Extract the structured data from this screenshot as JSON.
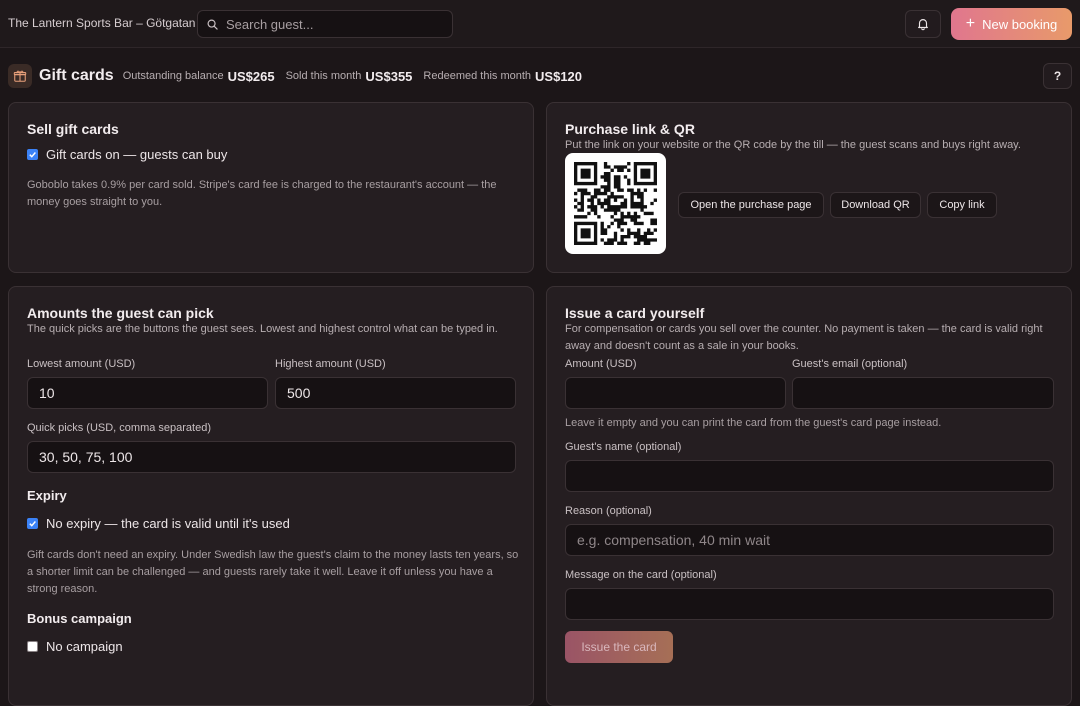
{
  "app": {
    "venue": "The Lantern Sports Bar – Götgatan",
    "search_placeholder": "Search guest...",
    "new_booking": "New booking"
  },
  "page": {
    "title": "Gift cards",
    "stats": [
      {
        "label": "Outstanding balance",
        "value": "US$265"
      },
      {
        "label": "Sold this month",
        "value": "US$355"
      },
      {
        "label": "Redeemed this month",
        "value": "US$120"
      }
    ],
    "help": "?"
  },
  "sell": {
    "title": "Sell gift cards",
    "toggle_label": "Gift cards on — guests can buy",
    "toggle_checked": true,
    "note": "Goboblo takes 0.9% per card sold. Stripe's card fee is charged to the restaurant's account — the money goes straight to you."
  },
  "purchase": {
    "title": "Purchase link & QR",
    "description": "Put the link on your website or the QR code by the till — the guest scans and buys right away.",
    "buttons": {
      "open": "Open the purchase page",
      "download": "Download QR",
      "copy": "Copy link"
    }
  },
  "amounts": {
    "title": "Amounts the guest can pick",
    "description": "The quick picks are the buttons the guest sees. Lowest and highest control what can be typed in.",
    "lowest_label": "Lowest amount (USD)",
    "lowest_value": "10",
    "highest_label": "Highest amount (USD)",
    "highest_value": "500",
    "quick_label": "Quick picks (USD, comma separated)",
    "quick_value": "30, 50, 75, 100",
    "expiry_title": "Expiry",
    "expiry_label": "No expiry — the card is valid until it's used",
    "expiry_checked": true,
    "expiry_note": "Gift cards don't need an expiry. Under Swedish law the guest's claim to the money lasts ten years, so a shorter limit can be challenged — and guests rarely take it well. Leave it off unless you have a strong reason.",
    "bonus_title": "Bonus campaign",
    "bonus_label": "No campaign",
    "bonus_checked": false
  },
  "issue": {
    "title": "Issue a card yourself",
    "description": "For compensation or cards you sell over the counter. No payment is taken — the card is valid right away and doesn't count as a sale in your books.",
    "amount_label": "Amount (USD)",
    "amount_value": "",
    "email_label": "Guest's email (optional)",
    "email_value": "",
    "email_hint": "Leave it empty and you can print the card from the guest's card page instead.",
    "name_label": "Guest's name (optional)",
    "name_value": "",
    "reason_label": "Reason (optional)",
    "reason_placeholder": "e.g. compensation, 40 min wait",
    "message_label": "Message on the card (optional)",
    "message_value": "",
    "submit": "Issue the card"
  },
  "colors": {
    "accent_start": "#e0768e",
    "accent_end": "#e89a6a",
    "checkbox": "#3b82f6",
    "background": "#1c1618",
    "card": "#251e21"
  }
}
